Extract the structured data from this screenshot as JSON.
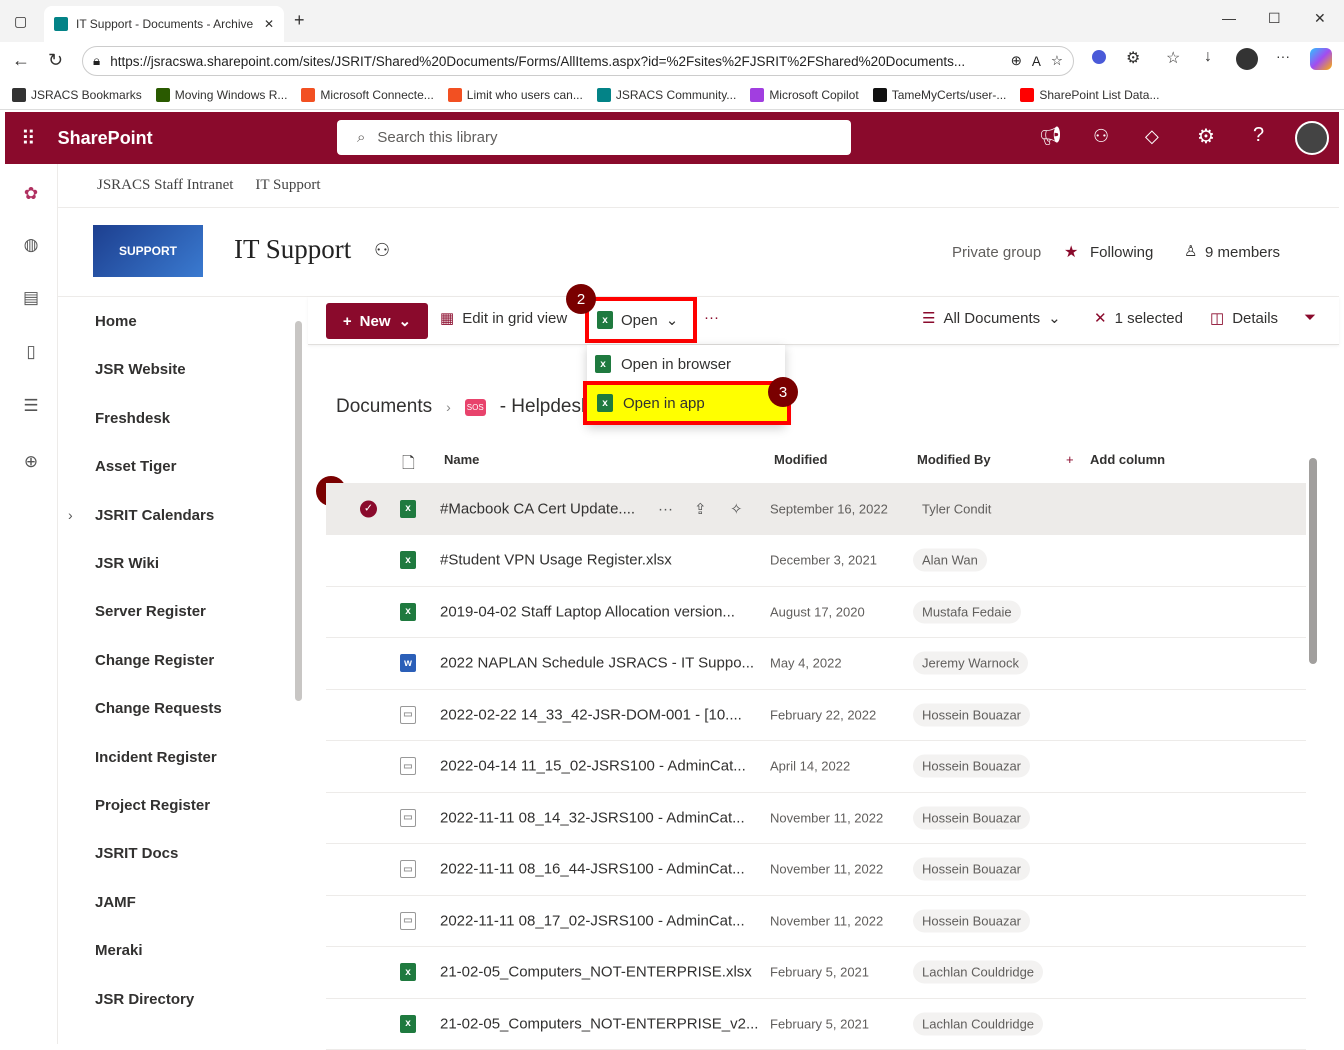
{
  "browser": {
    "tab_title": "IT Support - Documents - Archive",
    "url": "https://jsracswa.sharepoint.com/sites/JSRIT/Shared%20Documents/Forms/AllItems.aspx?id=%2Fsites%2FJSRIT%2FShared%20Documents...",
    "bookmarks": [
      {
        "label": "JSRACS Bookmarks",
        "color": "#333"
      },
      {
        "label": "Moving Windows R...",
        "color": "#2a5a00"
      },
      {
        "label": "Microsoft Connecte...",
        "color": "#f25022"
      },
      {
        "label": "Limit who users can...",
        "color": "#f25022"
      },
      {
        "label": "JSRACS Community...",
        "color": "#038387"
      },
      {
        "label": "Microsoft Copilot",
        "color": "#a13ee0"
      },
      {
        "label": "TameMyCerts/user-...",
        "color": "#111"
      },
      {
        "label": "SharePoint List Data...",
        "color": "#f00"
      }
    ]
  },
  "app": {
    "name": "SharePoint",
    "search_placeholder": "Search this library"
  },
  "breadcrumbs": [
    "JSRACS Staff Intranet",
    "IT Support"
  ],
  "site": {
    "logo_text": "SUPPORT",
    "title": "IT Support",
    "privacy": "Private group",
    "following": "Following",
    "members": "9 members"
  },
  "nav": [
    "Home",
    "JSR Website",
    "Freshdesk",
    "Asset Tiger",
    "JSRIT Calendars",
    "JSR Wiki",
    "Server Register",
    "Change Register",
    "Change Requests",
    "Incident Register",
    "Project Register",
    "JSRIT Docs",
    "JAMF",
    "Meraki",
    "JSR Directory"
  ],
  "toolbar": {
    "new": "New",
    "grid": "Edit in grid view",
    "open": "Open",
    "more": "···",
    "view": "All Documents",
    "selected": "1 selected",
    "details": "Details"
  },
  "menu": {
    "browser": "Open in browser",
    "app": "Open in app"
  },
  "badges": [
    "1",
    "2",
    "3"
  ],
  "path": {
    "root": "Documents",
    "folder_icon": "SOS",
    "folder": "- Helpdesk"
  },
  "columns": {
    "name": "Name",
    "modified": "Modified",
    "modified_by": "Modified By",
    "add": "Add column"
  },
  "files": [
    {
      "name": "#Macbook CA Cert Update....",
      "type": "xl",
      "modified": "September 16, 2022",
      "by": "Tyler Condit",
      "selected": true
    },
    {
      "name": "#Student VPN Usage Register.xlsx",
      "type": "xl",
      "modified": "December 3, 2021",
      "by": "Alan Wan"
    },
    {
      "name": "2019-04-02 Staff Laptop Allocation version...",
      "type": "xl",
      "modified": "August 17, 2020",
      "by": "Mustafa Fedaie"
    },
    {
      "name": "2022 NAPLAN Schedule JSRACS - IT Suppo...",
      "type": "wd",
      "modified": "May 4, 2022",
      "by": "Jeremy Warnock"
    },
    {
      "name": "2022-02-22 14_33_42-JSR-DOM-001 - [10....",
      "type": "img",
      "modified": "February 22, 2022",
      "by": "Hossein Bouazar"
    },
    {
      "name": "2022-04-14 11_15_02-JSRS100 - AdminCat...",
      "type": "img",
      "modified": "April 14, 2022",
      "by": "Hossein Bouazar"
    },
    {
      "name": "2022-11-11 08_14_32-JSRS100 - AdminCat...",
      "type": "img",
      "modified": "November 11, 2022",
      "by": "Hossein Bouazar"
    },
    {
      "name": "2022-11-11 08_16_44-JSRS100 - AdminCat...",
      "type": "img",
      "modified": "November 11, 2022",
      "by": "Hossein Bouazar"
    },
    {
      "name": "2022-11-11 08_17_02-JSRS100 - AdminCat...",
      "type": "img",
      "modified": "November 11, 2022",
      "by": "Hossein Bouazar"
    },
    {
      "name": "21-02-05_Computers_NOT-ENTERPRISE.xlsx",
      "type": "xl",
      "modified": "February 5, 2021",
      "by": "Lachlan Couldridge"
    },
    {
      "name": "21-02-05_Computers_NOT-ENTERPRISE_v2...",
      "type": "xl",
      "modified": "February 5, 2021",
      "by": "Lachlan Couldridge"
    }
  ]
}
